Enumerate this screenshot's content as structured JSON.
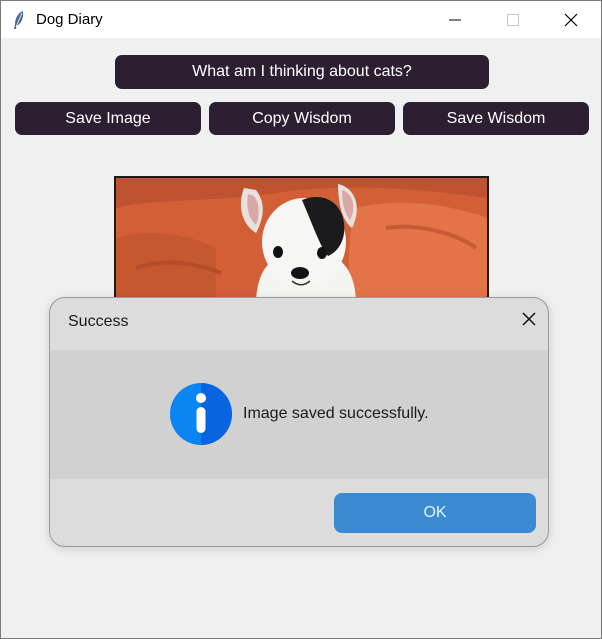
{
  "window": {
    "title": "Dog Diary",
    "controls": {
      "minimize_icon": "minimize-icon",
      "maximize_icon": "maximize-icon",
      "close_icon": "close-icon"
    }
  },
  "toolbar": {
    "think_label": "What am I thinking about cats?",
    "save_image_label": "Save Image",
    "copy_wisdom_label": "Copy Wisdom",
    "save_wisdom_label": "Save Wisdom",
    "button_color": "#2c1f31"
  },
  "image": {
    "icon": "dog-photo"
  },
  "dialog": {
    "title": "Success",
    "message": "Image saved successfully.",
    "ok_label": "OK",
    "icon": "info-icon",
    "ok_color": "#3a8bd1"
  }
}
